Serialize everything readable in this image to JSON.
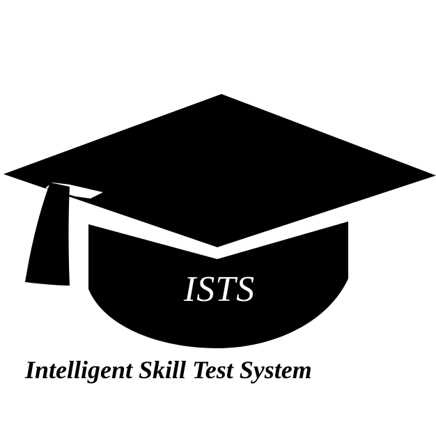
{
  "logo": {
    "acronym": "ISTS",
    "name": "Intelligent Skill Test System",
    "icon": "graduation-cap-icon",
    "colors": {
      "background": "#ffffff",
      "cap": "#000000",
      "acronym_text": "#ffffff",
      "name_text": "#000000"
    }
  }
}
